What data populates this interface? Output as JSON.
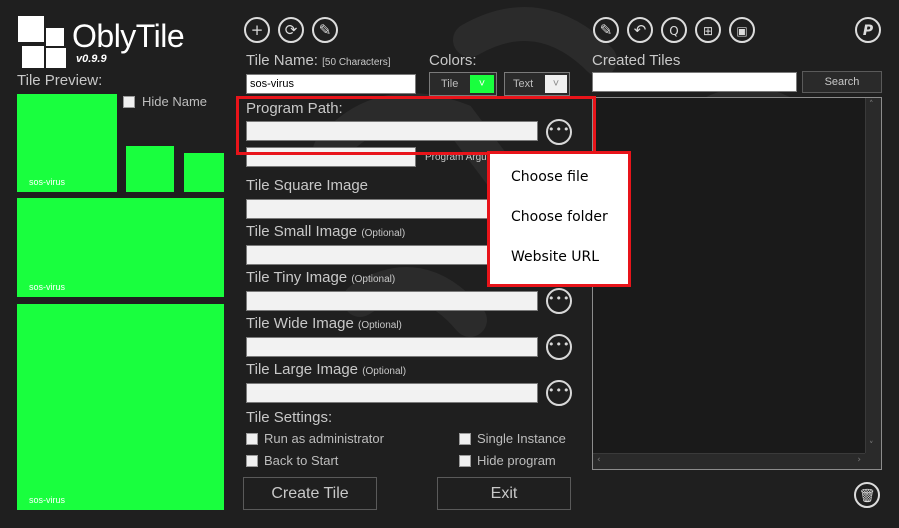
{
  "app": {
    "title": "OblyTile",
    "version": "v0.9.9"
  },
  "preview": {
    "label": "Tile Preview:",
    "hide_name_label": "Hide Name",
    "tile_text": "sos-virus",
    "tile_color": "#19ff3e"
  },
  "toolbar_left": {
    "add_icon": "plus-icon",
    "refresh_icon": "refresh-icon",
    "wrench_icon": "wrench-icon"
  },
  "form": {
    "tile_name_label": "Tile Name:",
    "tile_name_hint": "[50 Characters]",
    "tile_name_value": "sos-virus",
    "colors_label": "Colors:",
    "tile_color_label": "Tile",
    "text_color_label": "Text",
    "program_path_label": "Program Path:",
    "program_path_value": "",
    "program_args_label": "Program Argu",
    "program_args_value": "",
    "square_image_label": "Tile Square Image",
    "square_image_value": "",
    "small_image_label": "Tile Small Image",
    "tiny_image_label": "Tile Tiny Image",
    "wide_image_label": "Tile Wide Image",
    "large_image_label": "Tile Large Image",
    "optional_label": "(Optional)",
    "settings_label": "Tile Settings:",
    "run_admin_label": "Run as administrator",
    "back_to_start_label": "Back to Start",
    "single_instance_label": "Single Instance",
    "hide_program_label": "Hide program",
    "create_label": "Create Tile",
    "exit_label": "Exit"
  },
  "created": {
    "label": "Created Tiles",
    "search_value": "",
    "search_button": "Search"
  },
  "context_menu": {
    "items": [
      "Choose file",
      "Choose folder",
      "Website URL"
    ]
  },
  "colors": {
    "accent_red": "#e8141a",
    "background": "#1f1f1f"
  }
}
